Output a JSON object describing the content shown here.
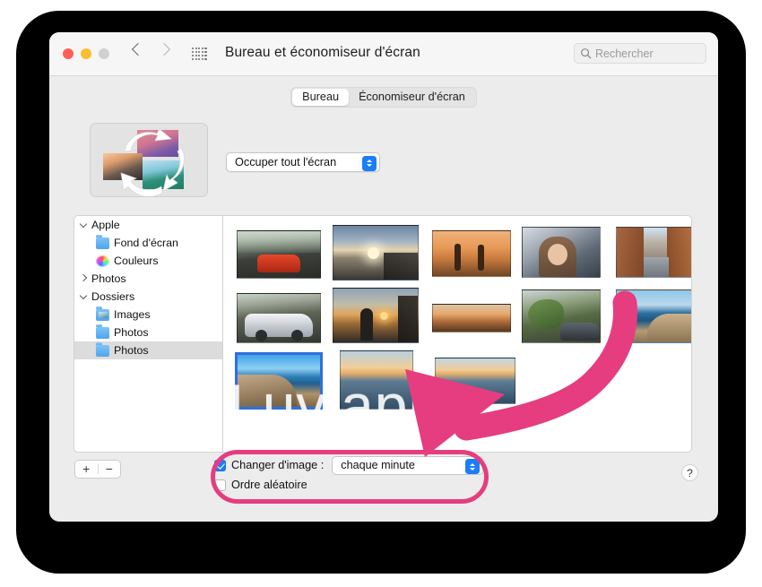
{
  "window": {
    "title": "Bureau et économiseur d'écran",
    "traffic_lights": [
      "close",
      "minimize",
      "zoom"
    ],
    "back_icon": "chevron-left-icon",
    "forward_icon": "chevron-right-icon",
    "grid_icon": "app-grid-icon",
    "search": {
      "placeholder": "Rechercher",
      "icon": "search-icon"
    }
  },
  "tabs": [
    {
      "label": "Bureau",
      "active": true
    },
    {
      "label": "Économiseur d'écran",
      "active": false
    }
  ],
  "preview": {
    "name": "wallpaper-rotation-preview",
    "icon": "rotating-images-icon"
  },
  "display_popup": {
    "value": "Occuper tout l'écran",
    "stepper_color": "#1b7ef6"
  },
  "sidebar": {
    "items": [
      {
        "label": "Apple",
        "icon": "disclosure-open",
        "indent": 0,
        "type": "group",
        "selected": false
      },
      {
        "label": "Fond d'écran",
        "icon": "folder-icon",
        "indent": 1,
        "type": "folder",
        "selected": false
      },
      {
        "label": "Couleurs",
        "icon": "color-wheel-icon",
        "indent": 1,
        "type": "colors",
        "selected": false
      },
      {
        "label": "Photos",
        "icon": "disclosure-closed",
        "indent": 0,
        "type": "group",
        "selected": false
      },
      {
        "label": "Dossiers",
        "icon": "disclosure-open",
        "indent": 0,
        "type": "group",
        "selected": false
      },
      {
        "label": "Images",
        "icon": "photos-folder-icon",
        "indent": 1,
        "type": "folder",
        "selected": false
      },
      {
        "label": "Photos",
        "icon": "folder-icon",
        "indent": 1,
        "type": "folder",
        "selected": false
      },
      {
        "label": "Photos",
        "icon": "folder-icon",
        "indent": 1,
        "type": "folder",
        "selected": true
      }
    ]
  },
  "grid": {
    "watermark": "Luviapp",
    "thumbnails": [
      {
        "name": "red-sports-car",
        "selected": false
      },
      {
        "name": "sunset-beach-rocks",
        "selected": false
      },
      {
        "name": "couple-silhouette",
        "selected": false
      },
      {
        "name": "portrait-woman",
        "selected": false
      },
      {
        "name": "european-street",
        "selected": false
      },
      {
        "name": "silver-sports-car",
        "selected": false
      },
      {
        "name": "person-sunset-pier",
        "selected": false
      },
      {
        "name": "city-sunset-panorama",
        "selected": false
      },
      {
        "name": "green-plants-car",
        "selected": false
      },
      {
        "name": "coastal-cliffs-sea",
        "selected": false
      },
      {
        "name": "cliff-coast-selected",
        "selected": true
      },
      {
        "name": "sea-sunset-horizon",
        "selected": false
      },
      {
        "name": "sea-sunset-wide",
        "selected": false
      }
    ]
  },
  "bottom_bar": {
    "add_label": "+",
    "remove_label": "−",
    "change_image": {
      "label": "Changer d'image :",
      "checked": true
    },
    "interval_popup": {
      "value": "chaque minute"
    },
    "random_order": {
      "label": "Ordre aléatoire",
      "checked": false
    },
    "help_label": "?"
  },
  "annotation": {
    "color": "#e53d7f",
    "arrow": "curved-arrow-pointing-to-options",
    "highlight_ring": "options-highlight-ring"
  }
}
